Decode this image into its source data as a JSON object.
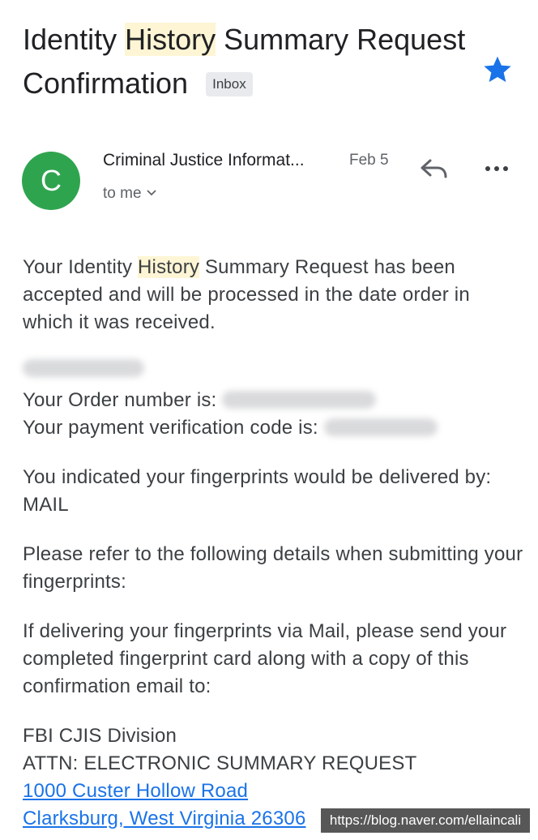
{
  "subject": {
    "part1": "Identity ",
    "highlight": "History",
    "part2": " Summary Request Confirmation",
    "label_badge": "Inbox"
  },
  "header": {
    "avatar_letter": "C",
    "sender": "Criminal Justice Informat...",
    "date": "Feb 5",
    "to": "to me"
  },
  "body": {
    "p1_a": "Your Identity ",
    "p1_highlight": "History",
    "p1_b": " Summary Request has been accepted and will be processed in the date order in which it was received.",
    "order_label": "Your Order number is: ",
    "verification_label": "Your payment verification code is: ",
    "p3": "You indicated your fingerprints would be delivered by: MAIL",
    "p4": "Please refer to the following details when submitting your fingerprints:",
    "p5": "If delivering your fingerprints via Mail, please send your completed fingerprint card along with a copy of this confirmation email to:",
    "address_line1": "FBI CJIS Division",
    "address_line2": "ATTN: ELECTRONIC SUMMARY REQUEST",
    "address_link1": "1000 Custer Hollow Road",
    "address_link2": "Clarksburg, West Virginia 26306"
  },
  "watermark": "https://blog.naver.com/ellaincali",
  "colors": {
    "avatar": "#2fa44f",
    "star": "#1a73e8",
    "link": "#1a73e8",
    "highlight": "#fdf5d4"
  },
  "icons": [
    "star-icon",
    "reply-icon",
    "more-options-icon",
    "chevron-down-icon"
  ]
}
